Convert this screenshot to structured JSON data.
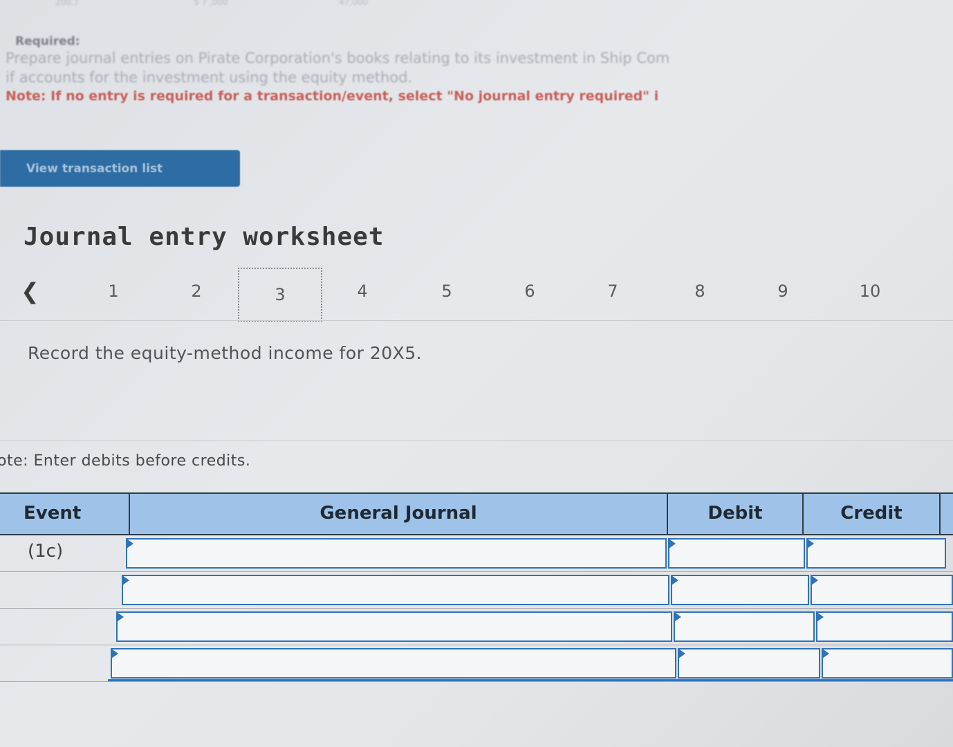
{
  "top_numbers": [
    "200,7",
    "5 7 ,000",
    "47,000"
  ],
  "required": {
    "title": "Required:",
    "line1": "Prepare journal entries on Pirate Corporation's books relating to its investment in Ship Com",
    "line2": "if accounts for the investment using the equity method.",
    "note": "Note: If no entry is required for a transaction/event, select \"No journal entry required\" i"
  },
  "view_button": "View transaction list",
  "worksheet": {
    "title": "Journal entry worksheet",
    "steps": [
      "1",
      "2",
      "3",
      "4",
      "5",
      "6",
      "7",
      "8",
      "9",
      "10"
    ],
    "active_step": "3",
    "instruction": "Record the equity-method income for 20X5.",
    "note": "ote: Enter debits before credits."
  },
  "journal": {
    "headers": {
      "event": "Event",
      "general_journal": "General Journal",
      "debit": "Debit",
      "credit": "Credit"
    },
    "rows": [
      {
        "event": "(1c)",
        "account": "",
        "debit": "",
        "credit": ""
      },
      {
        "event": "",
        "account": "",
        "debit": "",
        "credit": ""
      },
      {
        "event": "",
        "account": "",
        "debit": "",
        "credit": ""
      },
      {
        "event": "",
        "account": "",
        "debit": "",
        "credit": ""
      }
    ]
  },
  "colors": {
    "header_bg": "#9fc3e8",
    "accent": "#2e73b8",
    "button": "#2e6da4"
  }
}
